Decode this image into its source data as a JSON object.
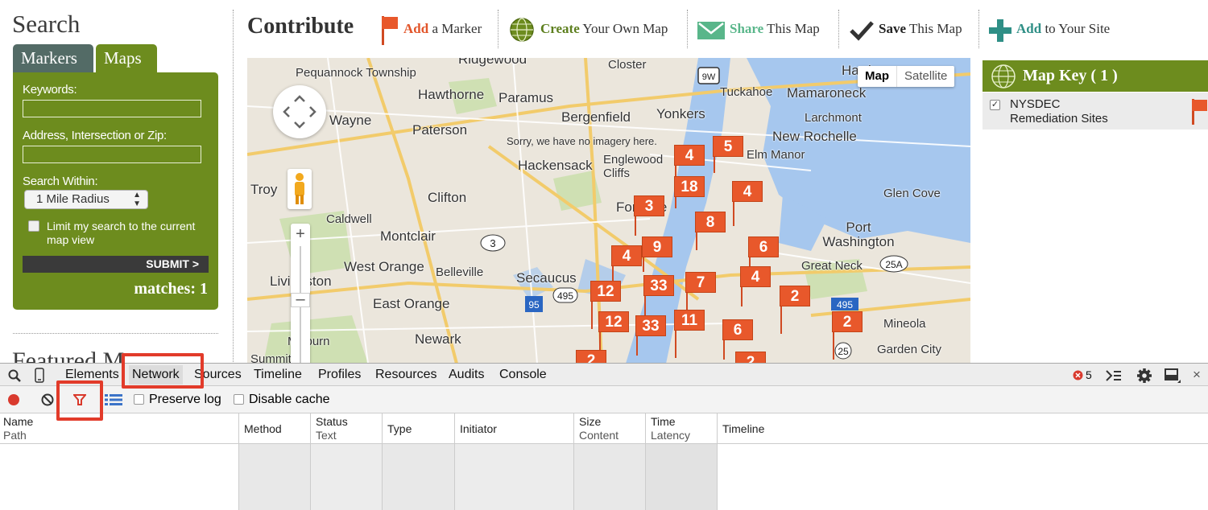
{
  "sidebar": {
    "title": "Search",
    "tabs": [
      "Markers",
      "Maps"
    ],
    "keywords_label": "Keywords:",
    "keywords_value": "",
    "address_label": "Address, Intersection or Zip:",
    "address_value": "",
    "within_label": "Search Within:",
    "radius_selected": "1 Mile Radius",
    "limit_label": "Limit my search to the current map view",
    "submit_label": "SUBMIT >",
    "matches": "matches: 1",
    "featured_title": "Featured M"
  },
  "contribute": {
    "title": "Contribute",
    "actions": [
      {
        "hl": "Add",
        "rest": " a Marker",
        "icon": "flag-icon"
      },
      {
        "hl": "Create",
        "rest": " Your Own Map",
        "icon": "globe-icon"
      },
      {
        "hl": "Share",
        "rest": " This Map",
        "icon": "envelope-icon"
      },
      {
        "hl": "Save",
        "rest": " This Map",
        "icon": "checkmark-icon"
      },
      {
        "hl": "Add",
        "rest": " to Your Site",
        "icon": "plus-icon"
      }
    ]
  },
  "map": {
    "type_buttons": [
      "Map",
      "Satellite"
    ],
    "no_imagery": "Sorry, we have no imagery here.",
    "places": [
      "Ridgewood",
      "Pequannock Township",
      "Hawthorne",
      "Paramus",
      "Closter",
      "Harrison",
      "Tuckahoe",
      "Mamaroneck",
      "Wayne",
      "Yonkers",
      "Bergenfield",
      "Larchmont",
      "Paterson",
      "New Rochelle",
      "Englewood Cliffs",
      "Hackensack",
      "Elm Manor",
      "Troy",
      "Clifton",
      "Fort Lee",
      "Glen Cove",
      "Caldwell",
      "Montclair",
      "Port Washington",
      "West Orange",
      "Belleville",
      "Great Neck",
      "Livingston",
      "Secaucus",
      "East Orange",
      "Newark",
      "Millburn",
      "Mineola",
      "Garden City",
      "Summit"
    ],
    "route_shields": [
      "9W",
      "3",
      "495",
      "95",
      "25A",
      "495",
      "25"
    ],
    "markers": [
      "4",
      "5",
      "18",
      "4",
      "3",
      "8",
      "9",
      "6",
      "4",
      "33",
      "7",
      "4",
      "12",
      "2",
      "12",
      "33",
      "11",
      "6",
      "2",
      "2",
      "2"
    ]
  },
  "map_key": {
    "title": "Map Key ( 1 )",
    "items": [
      {
        "line1": "NYSDEC",
        "line2": "Remediation Sites",
        "checked": "✓"
      }
    ]
  },
  "devtools": {
    "tabs": [
      "Elements",
      "Network",
      "Sources",
      "Timeline",
      "Profiles",
      "Resources",
      "Audits",
      "Console"
    ],
    "error_count": "5",
    "preserve_log": "Preserve log",
    "disable_cache": "Disable cache",
    "columns": [
      {
        "top": "Name",
        "sub": "Path"
      },
      {
        "top": "Method",
        "sub": ""
      },
      {
        "top": "Status",
        "sub": "Text"
      },
      {
        "top": "Type",
        "sub": ""
      },
      {
        "top": "Initiator",
        "sub": ""
      },
      {
        "top": "Size",
        "sub": "Content"
      },
      {
        "top": "Time",
        "sub": "Latency"
      },
      {
        "top": "Timeline",
        "sub": ""
      }
    ],
    "colors": {
      "record": "#d93a2e",
      "filter": "#d9382a",
      "highlight": "#e23b2a"
    }
  }
}
